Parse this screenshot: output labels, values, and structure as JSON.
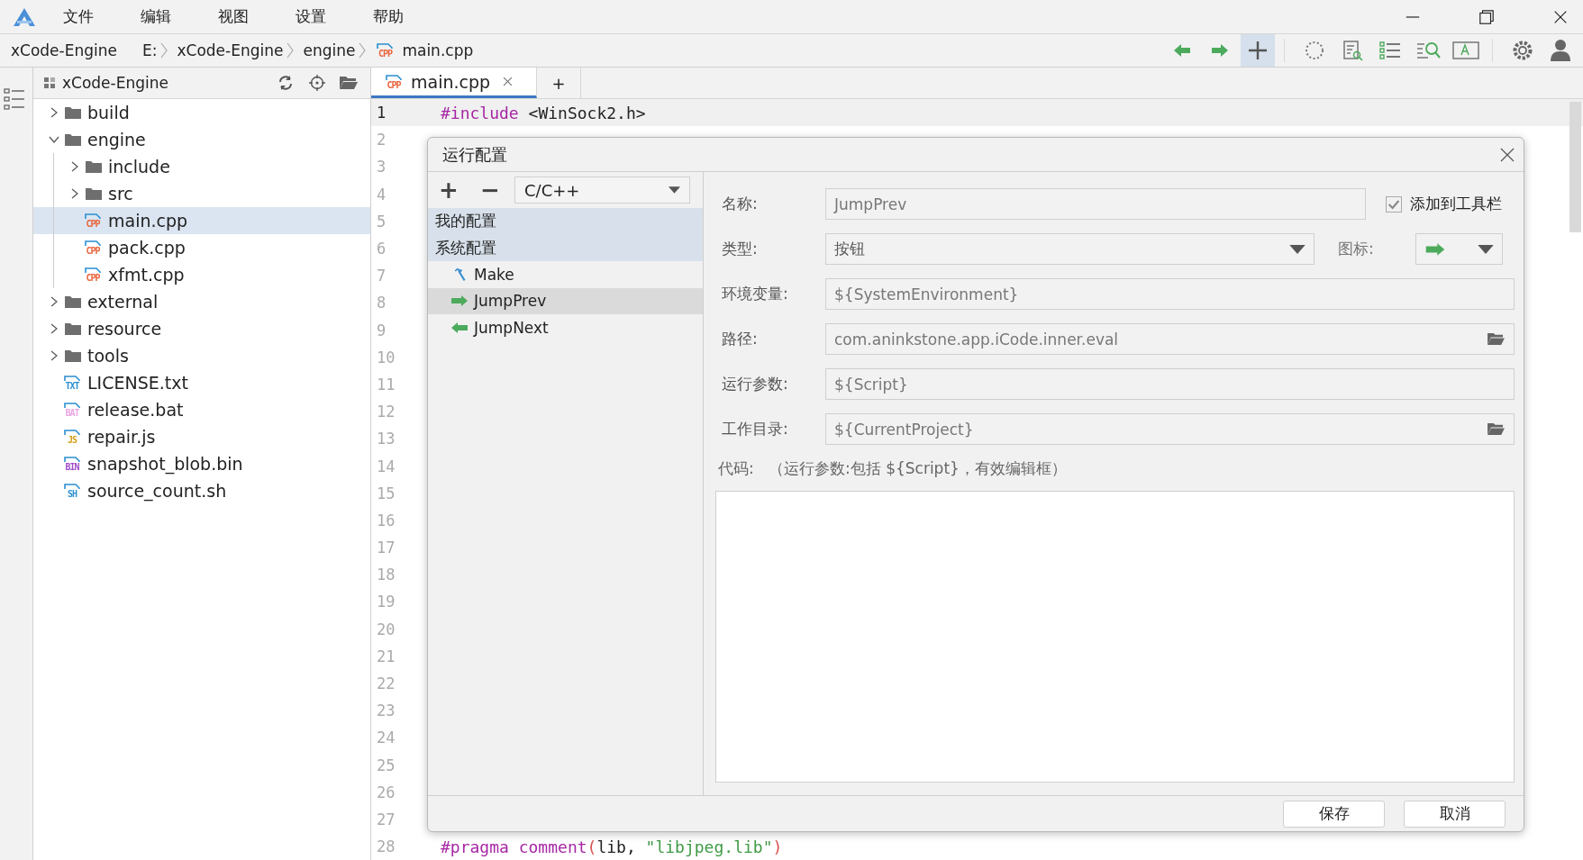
{
  "menu": [
    "文件",
    "编辑",
    "视图",
    "设置",
    "帮助"
  ],
  "breadcrumb": {
    "project": "xCode-Engine",
    "crumbs": [
      {
        "label": "E:"
      },
      {
        "label": "xCode-Engine"
      },
      {
        "label": "engine"
      },
      {
        "label": "main.cpp",
        "badge": "CPP",
        "color": "#e8643c"
      }
    ]
  },
  "toolbar": [
    {
      "selected": false
    },
    {
      "selected": false
    },
    {
      "selected": true
    },
    {
      "selected": false
    },
    {
      "selected": false
    },
    {
      "selected": false
    },
    {
      "selected": false
    },
    {
      "selected": false
    },
    {
      "selected": false
    },
    {
      "selected": false
    }
  ],
  "sidebar": {
    "title": "xCode-Engine",
    "tree": [
      {
        "label": "build",
        "kind": "folder",
        "expanded": false,
        "selected": false
      },
      {
        "label": "engine",
        "kind": "folder",
        "expanded": true,
        "selected": false,
        "children": [
          {
            "label": "include",
            "kind": "folder",
            "expanded": false,
            "selected": false
          },
          {
            "label": "src",
            "kind": "folder",
            "expanded": false,
            "selected": false
          },
          {
            "label": "main.cpp",
            "kind": "file",
            "badge": "CPP",
            "color": "#e8643c",
            "selected": true
          },
          {
            "label": "pack.cpp",
            "kind": "file",
            "badge": "CPP",
            "color": "#e8643c",
            "selected": false
          },
          {
            "label": "xfmt.cpp",
            "kind": "file",
            "badge": "CPP",
            "color": "#e8643c",
            "selected": false
          }
        ]
      },
      {
        "label": "external",
        "kind": "folder",
        "expanded": false,
        "selected": false
      },
      {
        "label": "resource",
        "kind": "folder",
        "expanded": false,
        "selected": false
      },
      {
        "label": "tools",
        "kind": "folder",
        "expanded": false,
        "selected": false
      },
      {
        "label": "LICENSE.txt",
        "kind": "file",
        "badge": "TXT",
        "color": "#2a8fd0",
        "selected": false
      },
      {
        "label": "release.bat",
        "kind": "file",
        "badge": "BAT",
        "color": "#e9a6e4",
        "selected": false
      },
      {
        "label": "repair.js",
        "kind": "file",
        "badge": "JS",
        "color": "#d4a017",
        "selected": false
      },
      {
        "label": "snapshot_blob.bin",
        "kind": "file",
        "badge": "BIN",
        "color": "#a04bc8",
        "selected": false
      },
      {
        "label": "source_count.sh",
        "kind": "file",
        "badge": "SH",
        "color": "#2a8fd0",
        "selected": false
      }
    ]
  },
  "editor": {
    "tabs": [
      {
        "label": "main.cpp",
        "badge": "CPP",
        "color": "#e8643c",
        "selected": true
      }
    ],
    "new_tab": "+",
    "lines": [
      {
        "number": "1",
        "current": true,
        "tokens": [
          {
            "text": "#include",
            "kind": "keyword"
          },
          {
            "text": " <WinSock2.h>",
            "kind": "plain"
          }
        ]
      },
      {
        "number": "2",
        "current": false
      },
      {
        "number": "3",
        "current": false
      },
      {
        "number": "4",
        "current": false
      },
      {
        "number": "5",
        "current": false
      },
      {
        "number": "6",
        "current": false
      },
      {
        "number": "7",
        "current": false
      },
      {
        "number": "8",
        "current": false
      },
      {
        "number": "9",
        "current": false
      },
      {
        "number": "10",
        "current": false
      },
      {
        "number": "11",
        "current": false
      },
      {
        "number": "12",
        "current": false
      },
      {
        "number": "13",
        "current": false
      },
      {
        "number": "14",
        "current": false
      },
      {
        "number": "15",
        "current": false
      },
      {
        "number": "16",
        "current": false
      },
      {
        "number": "17",
        "current": false
      },
      {
        "number": "18",
        "current": false
      },
      {
        "number": "19",
        "current": false
      },
      {
        "number": "20",
        "current": false
      },
      {
        "number": "21",
        "current": false
      },
      {
        "number": "22",
        "current": false
      },
      {
        "number": "23",
        "current": false
      },
      {
        "number": "24",
        "current": false
      },
      {
        "number": "25",
        "current": false
      },
      {
        "number": "26",
        "current": false
      },
      {
        "number": "27",
        "current": false
      },
      {
        "number": "28",
        "current": false,
        "tokens": [
          {
            "text": "#pragma",
            "kind": "keyword"
          },
          {
            "text": " comment",
            "kind": "keyword"
          },
          {
            "text": "(",
            "kind": "punct"
          },
          {
            "text": "lib, ",
            "kind": "plain"
          },
          {
            "text": "\"libjpeg.lib\"",
            "kind": "string"
          },
          {
            "text": ")",
            "kind": "punct"
          }
        ]
      }
    ]
  },
  "dialog": {
    "title": "运行配置",
    "add": "+",
    "remove": "−",
    "language": "C/C++",
    "config_tree": [
      {
        "label": "我的配置"
      },
      {
        "label": "系统配置",
        "children": [
          {
            "label": "Make",
            "selected": false
          },
          {
            "label": "JumpPrev",
            "selected": true
          },
          {
            "label": "JumpNext",
            "selected": false
          }
        ]
      }
    ],
    "name": {
      "label": "名称:",
      "value": "JumpPrev"
    },
    "add_to_toolbar": {
      "label": "添加到工具栏",
      "checked": true
    },
    "type": {
      "label": "类型:",
      "value": "按钮"
    },
    "icon": {
      "label": "图标:"
    },
    "fields": [
      {
        "label": "环境变量:",
        "value": "${SystemEnvironment}",
        "kind": "text"
      },
      {
        "label": "路径:",
        "value": "com.aninkstone.app.iCode.inner.eval",
        "kind": "path"
      },
      {
        "label": "运行参数:",
        "value": "${Script}",
        "kind": "text"
      },
      {
        "label": "工作目录:",
        "value": "${CurrentProject}",
        "kind": "path"
      }
    ],
    "code": {
      "label": "代码:",
      "hint": "（运行参数:包括 ${Script}，有效编辑框）"
    },
    "buttons": [
      "保存",
      "取消"
    ]
  }
}
